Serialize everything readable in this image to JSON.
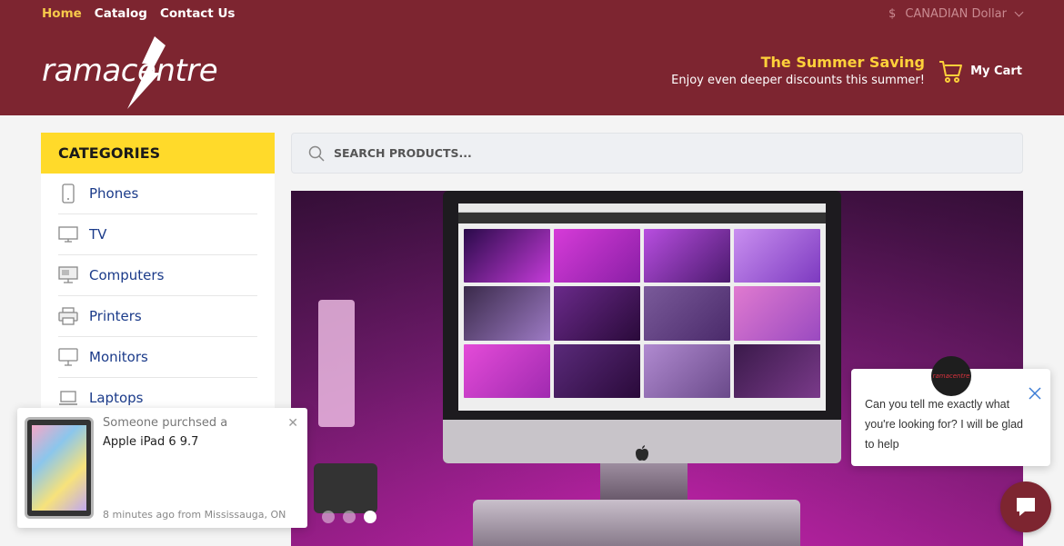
{
  "nav": {
    "items": [
      {
        "label": "Home",
        "active": true
      },
      {
        "label": "Catalog",
        "active": false
      },
      {
        "label": "Contact Us",
        "active": false
      }
    ]
  },
  "currency": {
    "symbol": "$",
    "label": "CANADIAN Dollar"
  },
  "brand": {
    "name": "ramacentre"
  },
  "promo": {
    "title": "The Summer Saving",
    "subtitle": "Enjoy even deeper discounts this summer!"
  },
  "cart": {
    "label": "My Cart"
  },
  "categories": {
    "title": "CATEGORIES",
    "items": [
      {
        "label": "Phones",
        "icon": "phone-icon"
      },
      {
        "label": "TV",
        "icon": "tv-icon"
      },
      {
        "label": "Computers",
        "icon": "computer-icon"
      },
      {
        "label": "Printers",
        "icon": "printer-icon"
      },
      {
        "label": "Monitors",
        "icon": "monitor-icon"
      },
      {
        "label": "Laptops",
        "icon": "laptop-icon"
      }
    ]
  },
  "search": {
    "placeholder": "SEARCH PRODUCTS..."
  },
  "slider": {
    "slide_count": 3,
    "active_index": 2
  },
  "notification": {
    "line1": "Someone purchsed a",
    "product": "Apple iPad 6 9.7",
    "meta": "8 minutes ago from Mississauga, ON"
  },
  "chat": {
    "message": "Can you tell me exactly what you're looking for? I will be glad to help",
    "avatar_text": "ramacentre"
  },
  "colors": {
    "header": "#7d2530",
    "accent_yellow": "#ffda2a",
    "link_blue": "#1b3b8a",
    "active_nav": "#f6c94a"
  }
}
